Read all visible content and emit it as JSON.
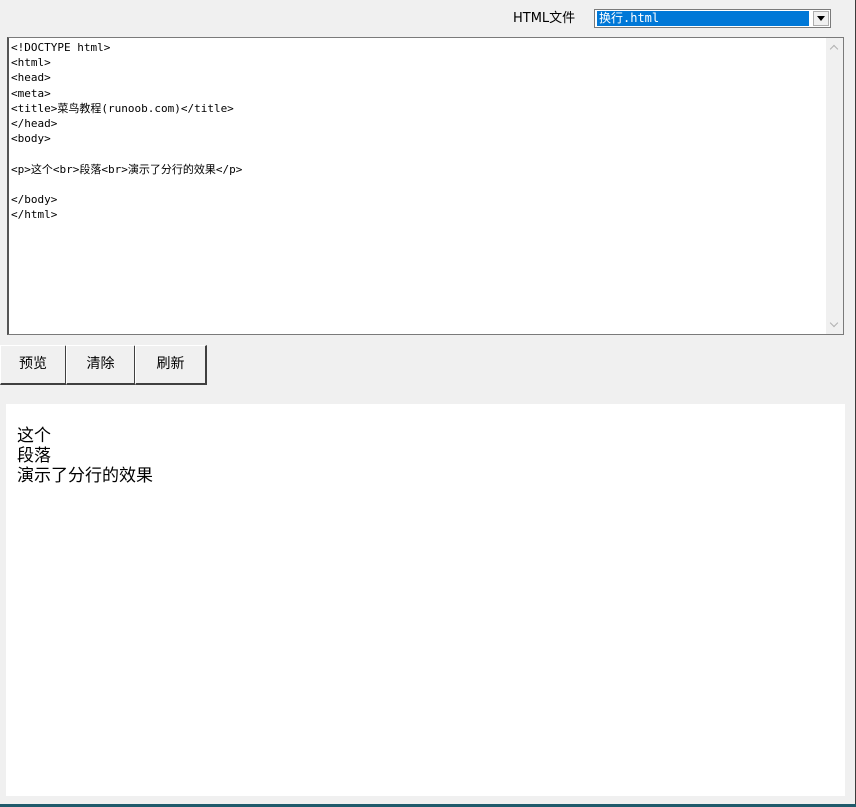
{
  "header": {
    "file_label": "HTML文件",
    "file_select": {
      "selected": "换行.html"
    }
  },
  "editor": {
    "lines": [
      "<!DOCTYPE html>",
      "<html>",
      "<head>",
      "<meta>",
      "<title>菜鸟教程(runoob.com)</title>",
      "</head>",
      "<body>",
      "",
      "<p>这个<br>段落<br>演示了分行的效果</p>",
      "",
      "</body>",
      "</html>"
    ]
  },
  "toolbar": {
    "preview_label": "预览",
    "clear_label": "清除",
    "refresh_label": "刷新"
  },
  "preview": {
    "lines": [
      "这个",
      "段落",
      "演示了分行的效果"
    ]
  },
  "colors": {
    "window_bg": "#f0f0f0",
    "selection": "#0078d7"
  },
  "icons": {
    "dropdown": "chevron-down-icon",
    "scroll_up": "chevron-up-icon",
    "scroll_down": "chevron-down-icon"
  }
}
